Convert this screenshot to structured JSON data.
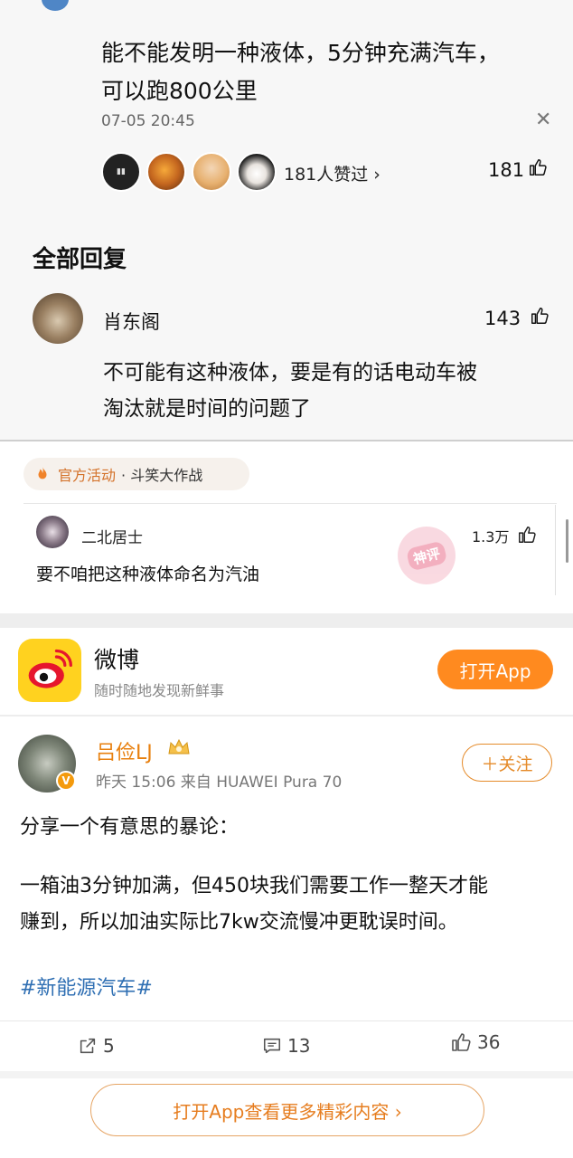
{
  "comment": {
    "content_line1": "能不能发明一种液体，5分钟充满汽车，",
    "content_line2": "可以跑800公里",
    "time": "07-05 20:45",
    "likers_text": "181人赞过 ›",
    "like_count": "181"
  },
  "replies": {
    "title": "全部回复",
    "reply": {
      "name": "肖东阁",
      "like_count": "143",
      "text_line1": "不可能有这种液体，要是有的话电动车被",
      "text_line2": "淘汰就是时间的问题了"
    }
  },
  "activity": {
    "label": "官方活动",
    "name": "· 斗笑大作战"
  },
  "top_comment": {
    "name": "二北居士",
    "like_count": "1.3万",
    "text": "要不咱把这种液体命名为汽油",
    "stamp": "神评"
  },
  "app_header": {
    "app_name": "微博",
    "slogan": "随时随地发现新鲜事",
    "open_button": "打开App"
  },
  "post": {
    "username": "吕俭LJ",
    "meta": "昨天 15:06  来自 HUAWEI Pura 70",
    "follow_label": "＋关注",
    "line1": "分享一个有意思的暴论：",
    "body_line1": "一箱油3分钟加满，但450块我们需要工作一整天才能",
    "body_line2": "赚到，所以加油实际比7kw交流慢冲更耽误时间。",
    "hashtag": "#新能源汽车#",
    "reposts": "5",
    "comments": "13",
    "likes": "36",
    "more_button": "打开App查看更多精彩内容 ›"
  },
  "colors": {
    "orange": "#ff8a1f",
    "username": "#e8800f",
    "hashtag": "#2f6fb3",
    "weibo_yellow": "#ffd21f"
  }
}
